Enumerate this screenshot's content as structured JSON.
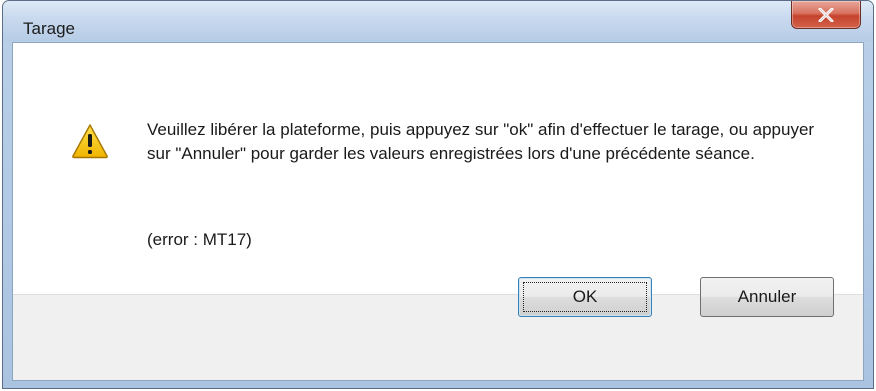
{
  "window": {
    "title": "Tarage"
  },
  "icons": {
    "close": "close-icon",
    "warning": "warning-icon"
  },
  "dialog": {
    "message": "Veuillez libérer la plateforme, puis appuyez sur \"ok\" afin d'effectuer le tarage, ou appuyer sur \"Annuler\" pour garder les valeurs enregistrées lors d'une précédente séance.",
    "error": "(error : MT17)"
  },
  "buttons": {
    "ok_label": "OK",
    "cancel_label": "Annuler"
  },
  "colors": {
    "close_button": "#c5432d",
    "warning_fill": "#f5c400",
    "default_button_border": "#3c7fb1"
  }
}
